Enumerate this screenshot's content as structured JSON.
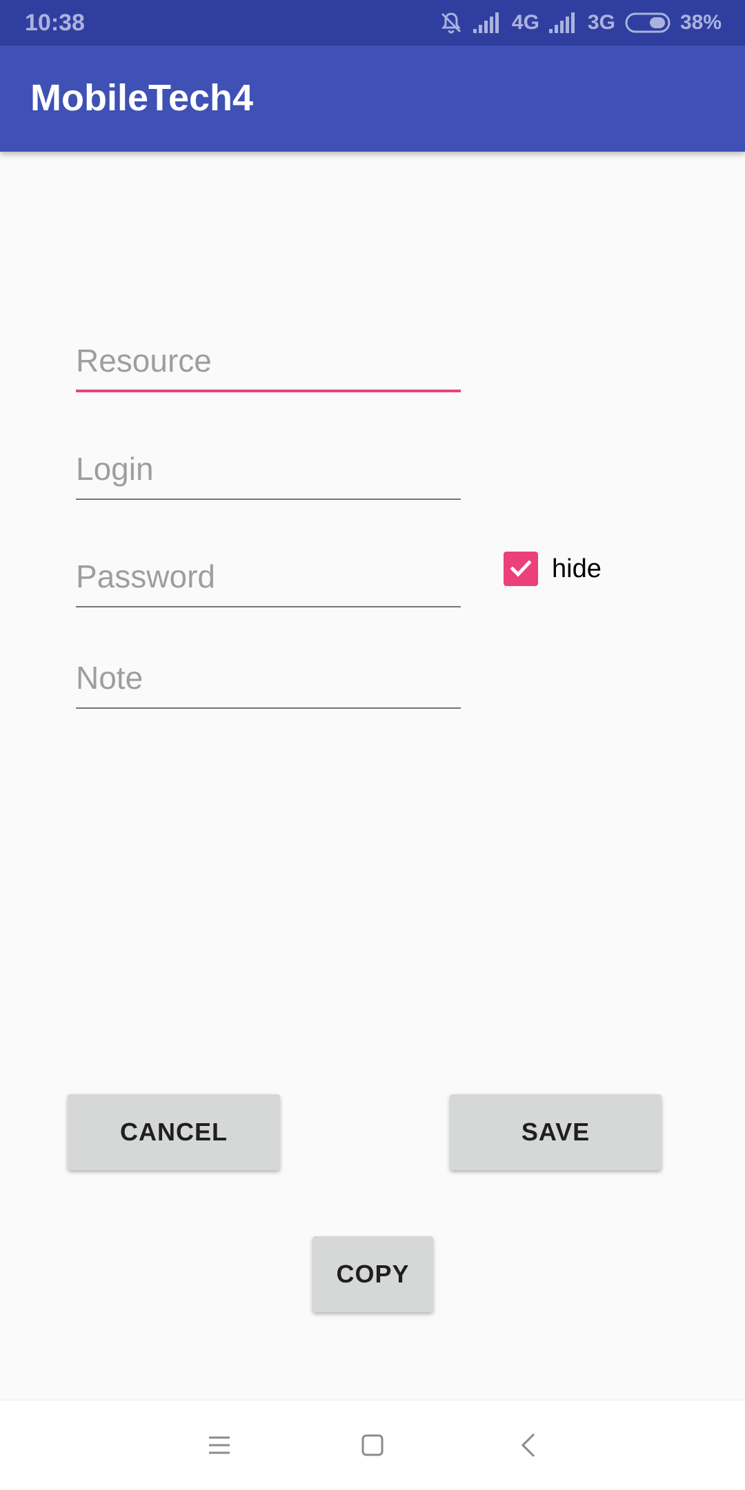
{
  "status_bar": {
    "time": "10:38",
    "network_1": "4G",
    "network_2": "3G",
    "battery_percent": "38%",
    "icons": [
      "bell-off-icon",
      "signal-icon",
      "battery-icon"
    ]
  },
  "app_bar": {
    "title": "MobileTech4",
    "color": "#3f51b5"
  },
  "form": {
    "resource": {
      "value": "",
      "placeholder": "Resource"
    },
    "login": {
      "value": "",
      "placeholder": "Login"
    },
    "password": {
      "value": "",
      "placeholder": "Password"
    },
    "note": {
      "value": "",
      "placeholder": "Note"
    },
    "accent_color": "#ec407a"
  },
  "hide_checkbox": {
    "label": "hide",
    "checked": true
  },
  "buttons": {
    "cancel": "CANCEL",
    "save": "SAVE",
    "copy": "COPY"
  },
  "nav_bar": {
    "icons": [
      "menu-icon",
      "home-icon",
      "back-icon"
    ]
  }
}
